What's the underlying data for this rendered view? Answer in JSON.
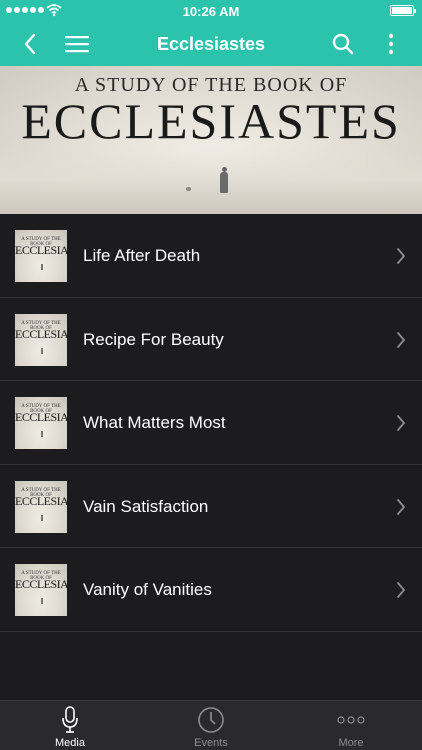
{
  "status_bar": {
    "time": "10:26 AM"
  },
  "header": {
    "title": "Ecclesiastes"
  },
  "banner": {
    "line1": "A STUDY OF THE BOOK OF",
    "line2": "ECCLESIASTES"
  },
  "thumbnail": {
    "line1": "A STUDY OF THE BOOK OF",
    "line2": "ECCLESIASTES"
  },
  "items": [
    {
      "label": "Life After Death"
    },
    {
      "label": "Recipe For Beauty"
    },
    {
      "label": "What Matters Most"
    },
    {
      "label": "Vain Satisfaction"
    },
    {
      "label": "Vanity of Vanities"
    }
  ],
  "tabs": [
    {
      "label": "Media",
      "icon": "microphone-icon",
      "active": true
    },
    {
      "label": "Events",
      "icon": "clock-icon",
      "active": false
    },
    {
      "label": "More",
      "icon": "more-dots-icon",
      "active": false
    }
  ],
  "colors": {
    "accent": "#2cc3ad",
    "background": "#1c1c1e",
    "tabbar": "#2a2a2c"
  }
}
